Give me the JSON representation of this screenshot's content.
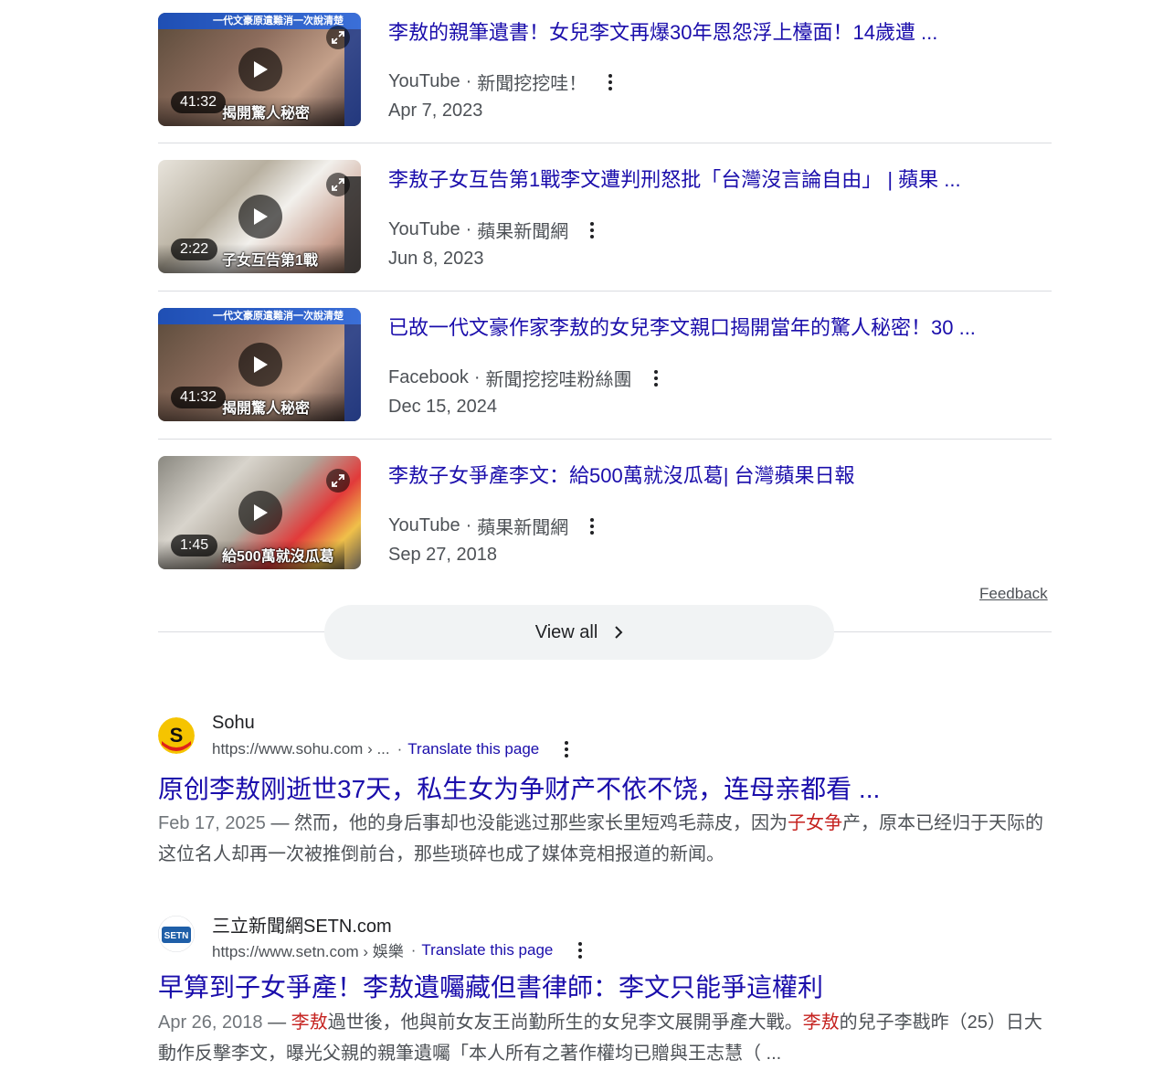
{
  "videos": [
    {
      "title": "李敖的親筆遺書！女兒李文再爆30年恩怨浮上檯面！14歲遭 ...",
      "source": "YouTube",
      "channel": "新聞挖挖哇！",
      "date": "Apr 7, 2023",
      "duration": "41:32",
      "thumb_banner": "一代文豪原遺難消一次說清楚",
      "thumb_caption": "揭開驚人秘密"
    },
    {
      "title": "李敖子女互告第1戰李文遭判刑怒批「台灣沒言論自由」 | 蘋果 ...",
      "source": "YouTube",
      "channel": "蘋果新聞網",
      "date": "Jun 8, 2023",
      "duration": "2:22",
      "thumb_banner": "",
      "thumb_caption": "子女互告第1戰"
    },
    {
      "title": "已故一代文豪作家李敖的女兒李文親口揭開當年的驚人秘密！30 ...",
      "source": "Facebook",
      "channel": "新聞挖挖哇粉絲團",
      "date": "Dec 15, 2024",
      "duration": "41:32",
      "thumb_banner": "一代文豪原遺難消一次說清楚",
      "thumb_caption": "揭開驚人秘密"
    },
    {
      "title": "李敖子女爭產李文：給500萬就沒瓜葛| 台灣蘋果日報",
      "source": "YouTube",
      "channel": "蘋果新聞網",
      "date": "Sep 27, 2018",
      "duration": "1:45",
      "thumb_banner": "",
      "thumb_caption": "給500萬就沒瓜葛"
    }
  ],
  "feedback_label": "Feedback",
  "view_all_label": "View all",
  "results": [
    {
      "site_name": "Sohu",
      "url": "https://www.sohu.com › ...",
      "translate": "Translate this page",
      "title": "原创李敖刚逝世37天，私生女为争财产不依不饶，连母亲都看 ...",
      "date": "Feb 17, 2025",
      "snippet_a": "然而，他的身后事却也没能逃过那些家长里短鸡毛蒜皮，因为",
      "snippet_hl": "子女争",
      "snippet_b": "产，原本已经归于天际的这位名人却再一次被推倒前台，那些琐碎也成了媒体竞相报道的新闻。",
      "logo_text": "S"
    },
    {
      "site_name": "三立新聞網SETN.com",
      "url": "https://www.setn.com › 娛樂",
      "translate": "Translate this page",
      "title": "早算到子女爭產！李敖遺囑藏但書律師：李文只能爭這權利",
      "date": "Apr 26, 2018",
      "snippet_hl1": "李敖",
      "snippet_a": "過世後，他與前女友王尚勤所生的女兒李文展開爭產大戰。",
      "snippet_hl2": "李敖",
      "snippet_b": "的兒子李戡昨（25）日大動作反擊李文，曝光父親的親筆遺囑「本人所有之著作權均已贈與王志慧（ ...",
      "logo_text": "SETN"
    }
  ],
  "separator": "·",
  "dash": "—"
}
